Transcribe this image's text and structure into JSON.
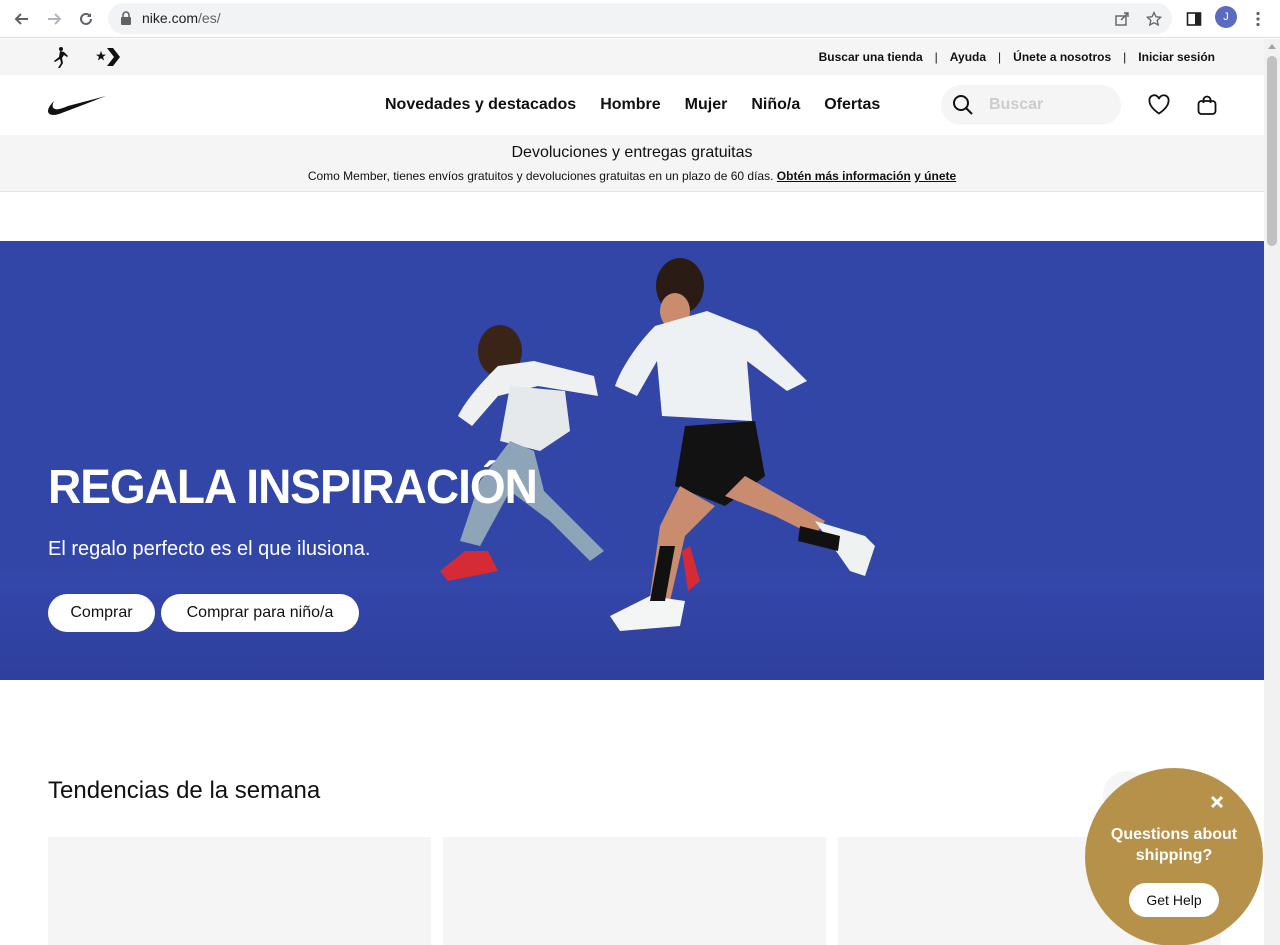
{
  "browser": {
    "url_host": "nike.com",
    "url_path": "/es/",
    "profile_initial": "J"
  },
  "utility_bar": {
    "links": [
      "Buscar una tienda",
      "Ayuda",
      "Únete a nosotros",
      "Iniciar sesión"
    ],
    "separator": "|"
  },
  "header": {
    "nav": [
      "Novedades y destacados",
      "Hombre",
      "Mujer",
      "Niño/a",
      "Ofertas"
    ],
    "search_placeholder": "Buscar"
  },
  "promo": {
    "title": "Devoluciones y entregas gratuitas",
    "description": "Como Member, tienes envíos gratuitos y devoluciones gratuitas en un plazo de 60 días.",
    "link_more": "Obtén más información",
    "link_join": "y únete"
  },
  "hero": {
    "title": "REGALA INSPIRACIÓN",
    "subtitle": "El regalo perfecto es el que ilusiona.",
    "buttons": [
      "Comprar",
      "Comprar para niño/a"
    ],
    "background_color": "#3246a8"
  },
  "trends": {
    "title": "Tendencias de la semana"
  },
  "help_widget": {
    "text": "Questions about shipping?",
    "button": "Get Help",
    "color": "#b6914a"
  }
}
